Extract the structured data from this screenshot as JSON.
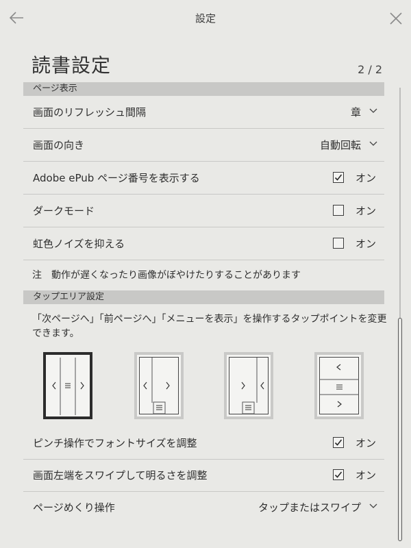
{
  "topbar": {
    "title": "設定",
    "back_icon": "arrow-left-icon",
    "close_icon": "close-icon"
  },
  "page": {
    "title": "読書設定",
    "page_indicator": "2 / 2"
  },
  "sections": {
    "page_display": {
      "header": "ページ表示"
    },
    "tap_area": {
      "header": "タップエリア設定"
    }
  },
  "rows": {
    "refresh": {
      "label": "画面のリフレッシュ間隔",
      "value": "章"
    },
    "orientation": {
      "label": "画面の向き",
      "value": "自動回転"
    },
    "adobe_page_numbers": {
      "label": "Adobe ePub ページ番号を表示する",
      "checked": true,
      "toggle_label": "オン"
    },
    "dark_mode": {
      "label": "ダークモード",
      "checked": false,
      "toggle_label": "オン"
    },
    "rainbow_noise": {
      "label": "虹色ノイズを抑える",
      "checked": false,
      "toggle_label": "オン"
    },
    "pinch_font_size": {
      "label": "ピンチ操作でフォントサイズを調整",
      "checked": true,
      "toggle_label": "オン"
    },
    "swipe_brightness": {
      "label": "画面左端をスワイプして明るさを調整",
      "checked": true,
      "toggle_label": "オン"
    },
    "page_turn": {
      "label": "ページめくり操作",
      "value": "タップまたはスワイプ"
    }
  },
  "note": "注　動作が遅くなったり画像がぼやけたりすることがあります",
  "tap_area_description": "「次ページへ」「前ページへ」「メニューを表示」を操作するタップポイントを変更できます。",
  "tap_layouts": {
    "selected_index": 0,
    "count": 4
  },
  "colors": {
    "background": "#e9e9e6",
    "section_header": "#c8c8c6",
    "text": "#2e2e2e",
    "divider": "#c8c8c6"
  }
}
